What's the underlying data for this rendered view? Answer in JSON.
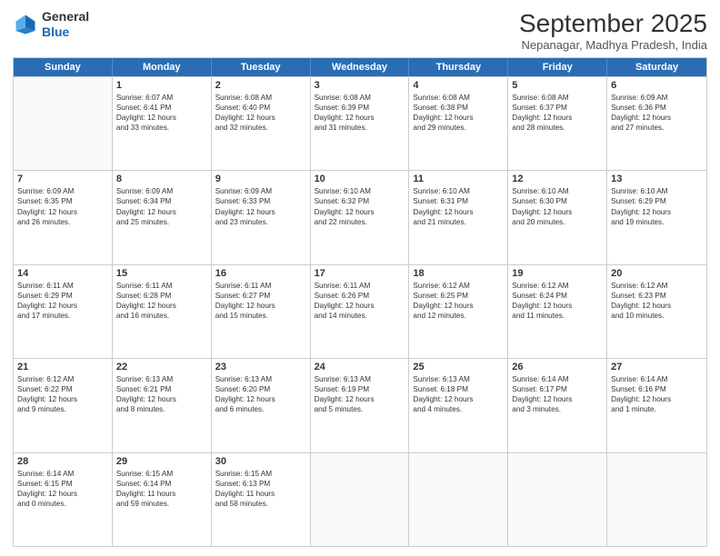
{
  "header": {
    "logo_general": "General",
    "logo_blue": "Blue",
    "month_title": "September 2025",
    "subtitle": "Nepanagar, Madhya Pradesh, India"
  },
  "days_of_week": [
    "Sunday",
    "Monday",
    "Tuesday",
    "Wednesday",
    "Thursday",
    "Friday",
    "Saturday"
  ],
  "weeks": [
    [
      {
        "day": "",
        "sunrise": "",
        "sunset": "",
        "daylight": ""
      },
      {
        "day": "1",
        "sunrise": "Sunrise: 6:07 AM",
        "sunset": "Sunset: 6:41 PM",
        "daylight": "Daylight: 12 hours",
        "daylight2": "and 33 minutes."
      },
      {
        "day": "2",
        "sunrise": "Sunrise: 6:08 AM",
        "sunset": "Sunset: 6:40 PM",
        "daylight": "Daylight: 12 hours",
        "daylight2": "and 32 minutes."
      },
      {
        "day": "3",
        "sunrise": "Sunrise: 6:08 AM",
        "sunset": "Sunset: 6:39 PM",
        "daylight": "Daylight: 12 hours",
        "daylight2": "and 31 minutes."
      },
      {
        "day": "4",
        "sunrise": "Sunrise: 6:08 AM",
        "sunset": "Sunset: 6:38 PM",
        "daylight": "Daylight: 12 hours",
        "daylight2": "and 29 minutes."
      },
      {
        "day": "5",
        "sunrise": "Sunrise: 6:08 AM",
        "sunset": "Sunset: 6:37 PM",
        "daylight": "Daylight: 12 hours",
        "daylight2": "and 28 minutes."
      },
      {
        "day": "6",
        "sunrise": "Sunrise: 6:09 AM",
        "sunset": "Sunset: 6:36 PM",
        "daylight": "Daylight: 12 hours",
        "daylight2": "and 27 minutes."
      }
    ],
    [
      {
        "day": "7",
        "sunrise": "Sunrise: 6:09 AM",
        "sunset": "Sunset: 6:35 PM",
        "daylight": "Daylight: 12 hours",
        "daylight2": "and 26 minutes."
      },
      {
        "day": "8",
        "sunrise": "Sunrise: 6:09 AM",
        "sunset": "Sunset: 6:34 PM",
        "daylight": "Daylight: 12 hours",
        "daylight2": "and 25 minutes."
      },
      {
        "day": "9",
        "sunrise": "Sunrise: 6:09 AM",
        "sunset": "Sunset: 6:33 PM",
        "daylight": "Daylight: 12 hours",
        "daylight2": "and 23 minutes."
      },
      {
        "day": "10",
        "sunrise": "Sunrise: 6:10 AM",
        "sunset": "Sunset: 6:32 PM",
        "daylight": "Daylight: 12 hours",
        "daylight2": "and 22 minutes."
      },
      {
        "day": "11",
        "sunrise": "Sunrise: 6:10 AM",
        "sunset": "Sunset: 6:31 PM",
        "daylight": "Daylight: 12 hours",
        "daylight2": "and 21 minutes."
      },
      {
        "day": "12",
        "sunrise": "Sunrise: 6:10 AM",
        "sunset": "Sunset: 6:30 PM",
        "daylight": "Daylight: 12 hours",
        "daylight2": "and 20 minutes."
      },
      {
        "day": "13",
        "sunrise": "Sunrise: 6:10 AM",
        "sunset": "Sunset: 6:29 PM",
        "daylight": "Daylight: 12 hours",
        "daylight2": "and 19 minutes."
      }
    ],
    [
      {
        "day": "14",
        "sunrise": "Sunrise: 6:11 AM",
        "sunset": "Sunset: 6:29 PM",
        "daylight": "Daylight: 12 hours",
        "daylight2": "and 17 minutes."
      },
      {
        "day": "15",
        "sunrise": "Sunrise: 6:11 AM",
        "sunset": "Sunset: 6:28 PM",
        "daylight": "Daylight: 12 hours",
        "daylight2": "and 16 minutes."
      },
      {
        "day": "16",
        "sunrise": "Sunrise: 6:11 AM",
        "sunset": "Sunset: 6:27 PM",
        "daylight": "Daylight: 12 hours",
        "daylight2": "and 15 minutes."
      },
      {
        "day": "17",
        "sunrise": "Sunrise: 6:11 AM",
        "sunset": "Sunset: 6:26 PM",
        "daylight": "Daylight: 12 hours",
        "daylight2": "and 14 minutes."
      },
      {
        "day": "18",
        "sunrise": "Sunrise: 6:12 AM",
        "sunset": "Sunset: 6:25 PM",
        "daylight": "Daylight: 12 hours",
        "daylight2": "and 12 minutes."
      },
      {
        "day": "19",
        "sunrise": "Sunrise: 6:12 AM",
        "sunset": "Sunset: 6:24 PM",
        "daylight": "Daylight: 12 hours",
        "daylight2": "and 11 minutes."
      },
      {
        "day": "20",
        "sunrise": "Sunrise: 6:12 AM",
        "sunset": "Sunset: 6:23 PM",
        "daylight": "Daylight: 12 hours",
        "daylight2": "and 10 minutes."
      }
    ],
    [
      {
        "day": "21",
        "sunrise": "Sunrise: 6:12 AM",
        "sunset": "Sunset: 6:22 PM",
        "daylight": "Daylight: 12 hours",
        "daylight2": "and 9 minutes."
      },
      {
        "day": "22",
        "sunrise": "Sunrise: 6:13 AM",
        "sunset": "Sunset: 6:21 PM",
        "daylight": "Daylight: 12 hours",
        "daylight2": "and 8 minutes."
      },
      {
        "day": "23",
        "sunrise": "Sunrise: 6:13 AM",
        "sunset": "Sunset: 6:20 PM",
        "daylight": "Daylight: 12 hours",
        "daylight2": "and 6 minutes."
      },
      {
        "day": "24",
        "sunrise": "Sunrise: 6:13 AM",
        "sunset": "Sunset: 6:19 PM",
        "daylight": "Daylight: 12 hours",
        "daylight2": "and 5 minutes."
      },
      {
        "day": "25",
        "sunrise": "Sunrise: 6:13 AM",
        "sunset": "Sunset: 6:18 PM",
        "daylight": "Daylight: 12 hours",
        "daylight2": "and 4 minutes."
      },
      {
        "day": "26",
        "sunrise": "Sunrise: 6:14 AM",
        "sunset": "Sunset: 6:17 PM",
        "daylight": "Daylight: 12 hours",
        "daylight2": "and 3 minutes."
      },
      {
        "day": "27",
        "sunrise": "Sunrise: 6:14 AM",
        "sunset": "Sunset: 6:16 PM",
        "daylight": "Daylight: 12 hours",
        "daylight2": "and 1 minute."
      }
    ],
    [
      {
        "day": "28",
        "sunrise": "Sunrise: 6:14 AM",
        "sunset": "Sunset: 6:15 PM",
        "daylight": "Daylight: 12 hours",
        "daylight2": "and 0 minutes."
      },
      {
        "day": "29",
        "sunrise": "Sunrise: 6:15 AM",
        "sunset": "Sunset: 6:14 PM",
        "daylight": "Daylight: 11 hours",
        "daylight2": "and 59 minutes."
      },
      {
        "day": "30",
        "sunrise": "Sunrise: 6:15 AM",
        "sunset": "Sunset: 6:13 PM",
        "daylight": "Daylight: 11 hours",
        "daylight2": "and 58 minutes."
      },
      {
        "day": "",
        "sunrise": "",
        "sunset": "",
        "daylight": "",
        "daylight2": ""
      },
      {
        "day": "",
        "sunrise": "",
        "sunset": "",
        "daylight": "",
        "daylight2": ""
      },
      {
        "day": "",
        "sunrise": "",
        "sunset": "",
        "daylight": "",
        "daylight2": ""
      },
      {
        "day": "",
        "sunrise": "",
        "sunset": "",
        "daylight": "",
        "daylight2": ""
      }
    ]
  ]
}
